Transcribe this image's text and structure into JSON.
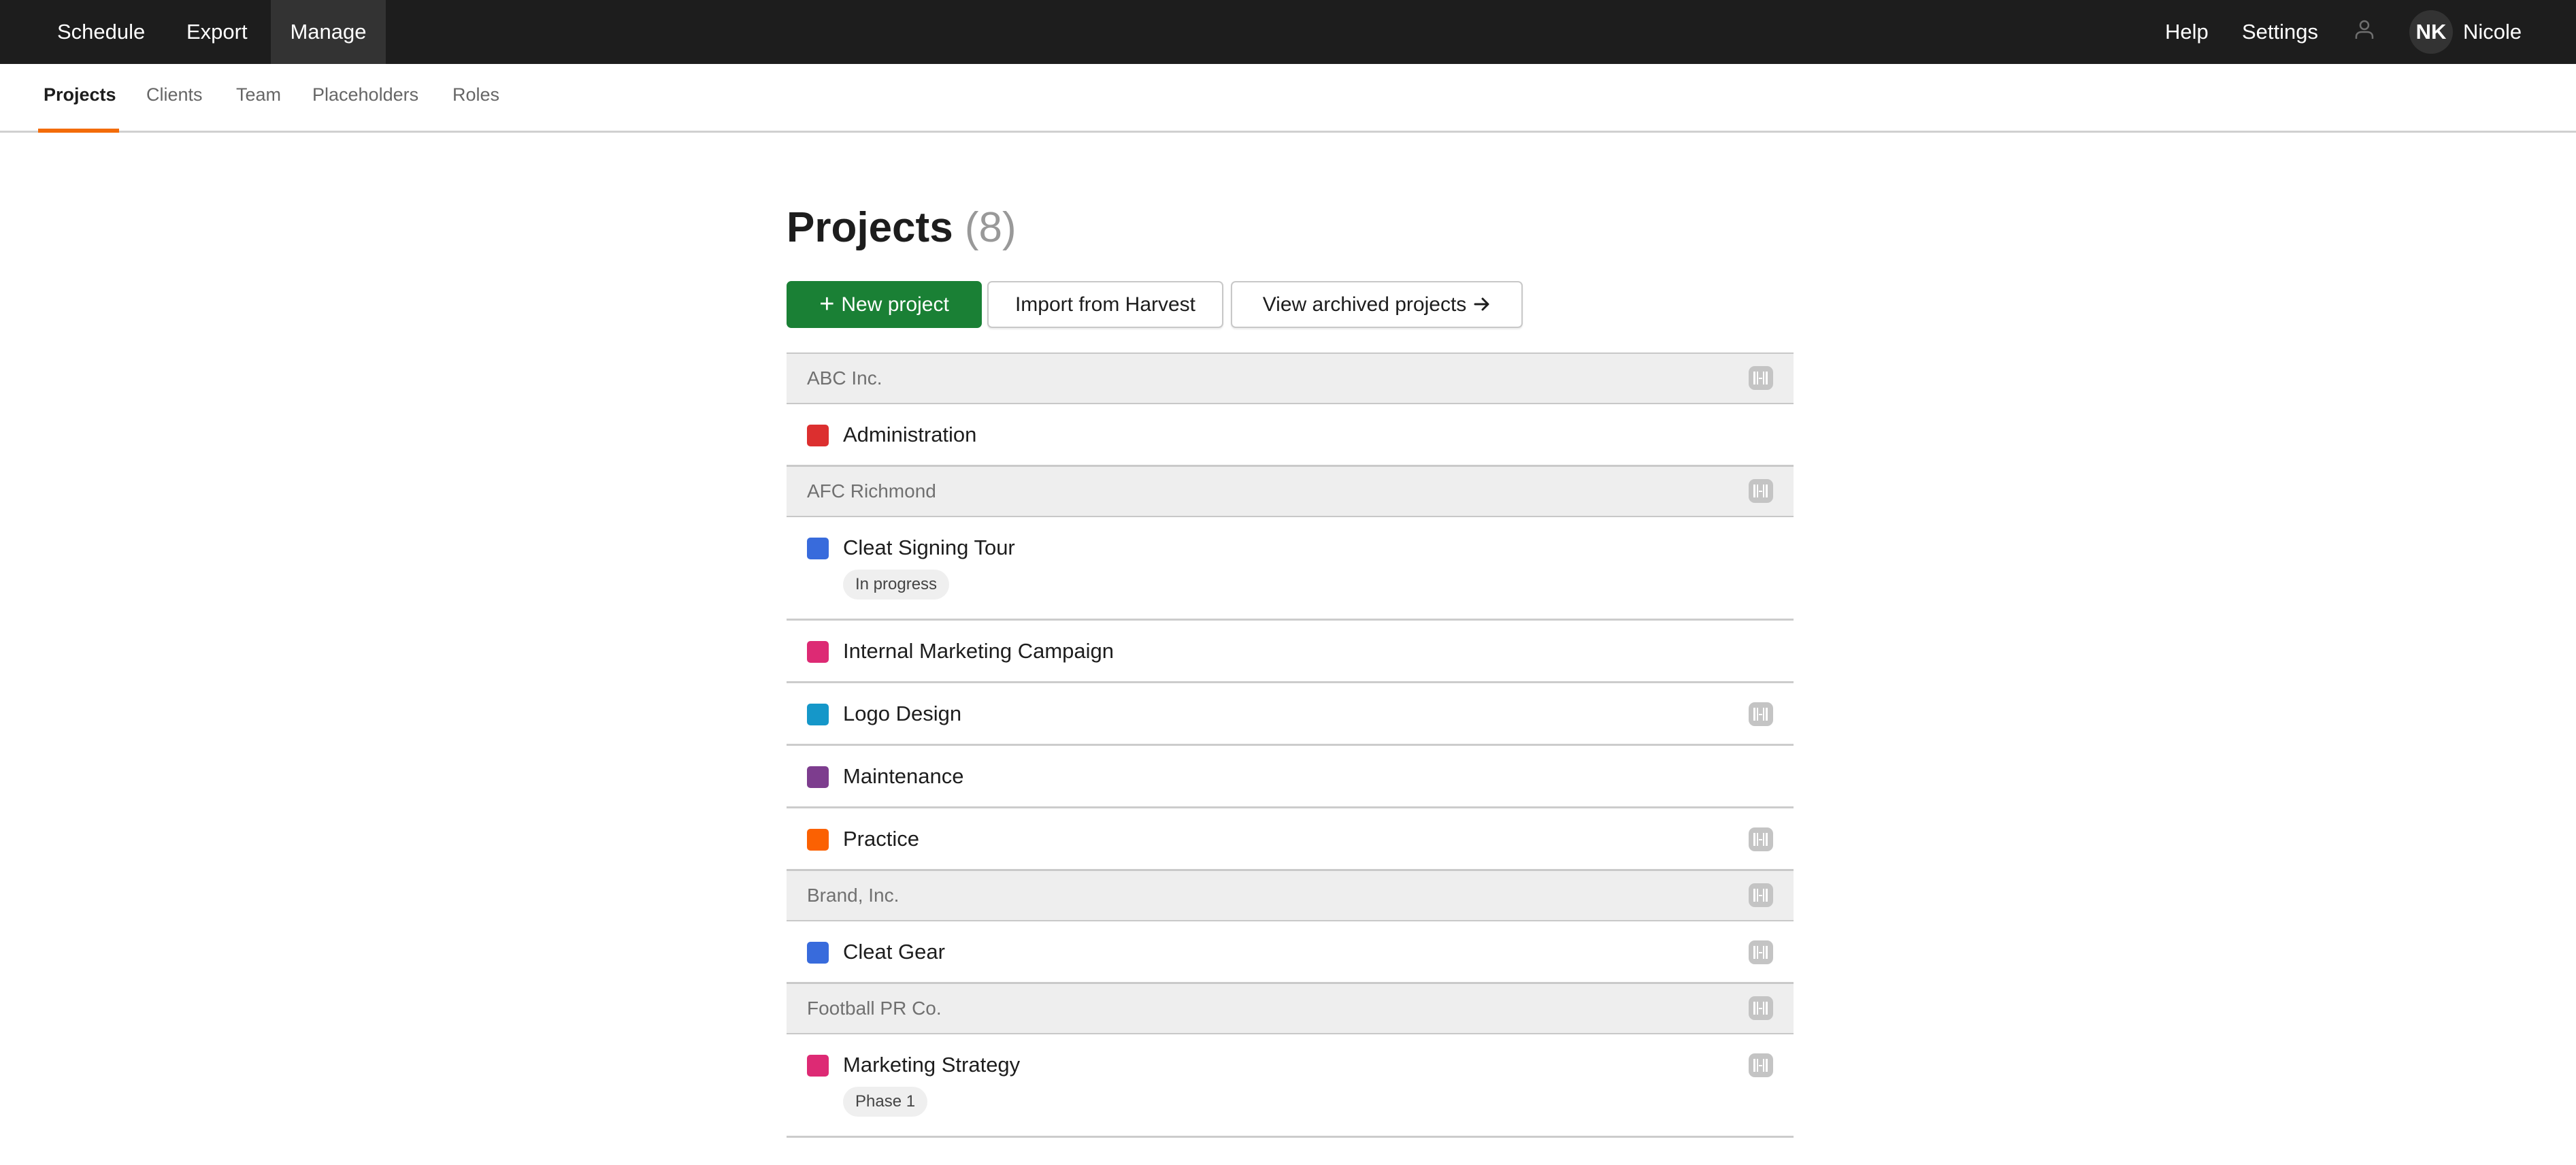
{
  "topbar": {
    "nav": [
      {
        "label": "Schedule",
        "active": false
      },
      {
        "label": "Export",
        "active": false
      },
      {
        "label": "Manage",
        "active": true
      }
    ],
    "help_label": "Help",
    "settings_label": "Settings",
    "person_icon": "person-icon",
    "user": {
      "initials": "NK",
      "name": "Nicole"
    }
  },
  "subnav": {
    "tabs": [
      {
        "label": "Projects",
        "active": true
      },
      {
        "label": "Clients",
        "active": false
      },
      {
        "label": "Team",
        "active": false
      },
      {
        "label": "Placeholders",
        "active": false
      },
      {
        "label": "Roles",
        "active": false
      }
    ],
    "accent_color": "#f36c0a"
  },
  "page": {
    "title": "Projects",
    "count": "(8)"
  },
  "actions": {
    "new_project_label": "New project",
    "new_project_icon": "plus-icon",
    "import_label": "Import from Harvest",
    "archived_label": "View archived projects",
    "archived_icon": "arrow-right-icon",
    "primary_color": "#1a8035"
  },
  "clients": [
    {
      "name": "ABC Inc.",
      "harvest": true,
      "projects": [
        {
          "name": "Administration",
          "color": "#dc2f2f",
          "badge": null,
          "harvest": false
        }
      ]
    },
    {
      "name": "AFC Richmond",
      "harvest": true,
      "projects": [
        {
          "name": "Cleat Signing Tour",
          "color": "#386bdc",
          "badge": "In progress",
          "harvest": false
        },
        {
          "name": "Internal Marketing Campaign",
          "color": "#dd2a74",
          "badge": null,
          "harvest": false
        },
        {
          "name": "Logo Design",
          "color": "#1597c9",
          "badge": null,
          "harvest": true
        },
        {
          "name": "Maintenance",
          "color": "#7d3d8e",
          "badge": null,
          "harvest": false
        },
        {
          "name": "Practice",
          "color": "#fb6102",
          "badge": null,
          "harvest": true
        }
      ]
    },
    {
      "name": "Brand, Inc.",
      "harvest": true,
      "projects": [
        {
          "name": "Cleat Gear",
          "color": "#386bdc",
          "badge": null,
          "harvest": true
        }
      ]
    },
    {
      "name": "Football PR Co.",
      "harvest": true,
      "projects": [
        {
          "name": "Marketing Strategy",
          "color": "#dd2a74",
          "badge": "Phase 1",
          "harvest": true
        }
      ]
    }
  ]
}
